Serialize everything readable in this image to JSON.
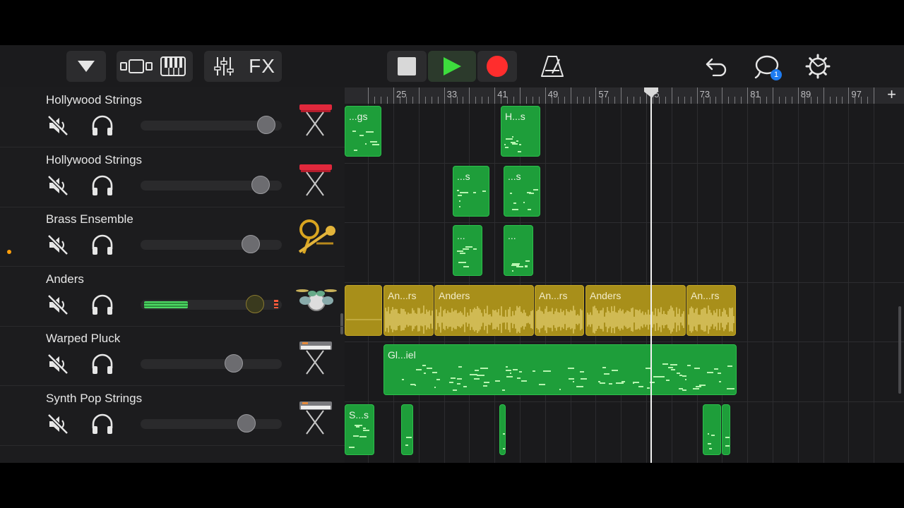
{
  "toolbar": {
    "view_dropdown": "tracks-dropdown",
    "fx_label": "FX",
    "notification_count": "1",
    "colors": {
      "play": "#3ddc3d",
      "record": "#ff2d2d"
    }
  },
  "ruler": {
    "labels": [
      "25",
      "33",
      "41",
      "49",
      "57",
      "65",
      "73",
      "81",
      "89",
      "97"
    ],
    "add_label": "+"
  },
  "tracks": [
    {
      "name": "Hollywood Strings",
      "instrument_icon": "keyboard-stand-icon",
      "volume": 0.89
    },
    {
      "name": "Hollywood Strings",
      "instrument_icon": "keyboard-stand-icon",
      "volume": 0.85
    },
    {
      "name": "Brass Ensemble",
      "instrument_icon": "brass-icon",
      "volume": 0.78
    },
    {
      "name": "Anders",
      "instrument_icon": "drum-kit-icon",
      "volume": 0.81,
      "meter_level": 0.31
    },
    {
      "name": "Warped Pluck",
      "instrument_icon": "synth-stand-icon",
      "volume": 0.66
    },
    {
      "name": "Synth Pop Strings",
      "instrument_icon": "synth-stand-icon",
      "volume": 0.75
    }
  ],
  "regions": {
    "t1": [
      "...gs",
      "H...s"
    ],
    "t2": [
      "...s",
      "...s"
    ],
    "t3": [
      "...",
      "..."
    ],
    "t4": [
      "",
      "An...rs",
      "Anders",
      "An...rs",
      "Anders",
      "",
      "An...rs"
    ],
    "t5": [
      "Gl...iel"
    ],
    "t6": [
      "S...s",
      "",
      "",
      "",
      ""
    ]
  }
}
